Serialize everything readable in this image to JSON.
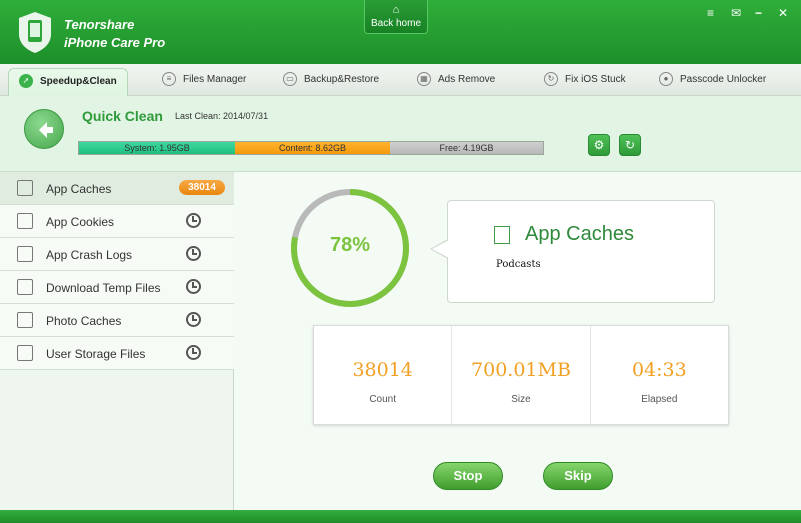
{
  "app": {
    "brand_line1": "Tenorshare",
    "brand_line2": "iPhone Care Pro",
    "back_home": "Back home"
  },
  "tabs": [
    {
      "label": "Speedup&Clean",
      "active": true,
      "icon": "rocket-icon"
    },
    {
      "label": "Files Manager",
      "icon": "files-icon"
    },
    {
      "label": "Backup&Restore",
      "icon": "folder-icon"
    },
    {
      "label": "Ads Remove",
      "icon": "grid-icon"
    },
    {
      "label": "Fix iOS Stuck",
      "icon": "fix-icon"
    },
    {
      "label": "Passcode Unlocker",
      "icon": "user-icon"
    }
  ],
  "quick_clean": {
    "title": "Quick Clean",
    "last_clean": "Last Clean: 2014/07/31",
    "system": "System: 1.95GB",
    "content": "Content: 8.62GB",
    "free": "Free: 4.19GB"
  },
  "sidebar": {
    "items": [
      {
        "label": "App Caches",
        "badge": "38014",
        "icon": "app-caches-icon"
      },
      {
        "label": "App Cookies",
        "icon": "cookies-icon"
      },
      {
        "label": "App Crash Logs",
        "icon": "crash-logs-icon"
      },
      {
        "label": "Download Temp Files",
        "icon": "download-icon"
      },
      {
        "label": "Photo Caches",
        "icon": "photo-icon"
      },
      {
        "label": "User Storage Files",
        "icon": "storage-icon"
      }
    ]
  },
  "progress": {
    "percent_text": "78%",
    "fraction": 0.78
  },
  "scan": {
    "title": "App Caches",
    "current_item": "Podcasts"
  },
  "stats": [
    {
      "value": "38014",
      "caption": "Count"
    },
    {
      "value": "700.01MB",
      "caption": "Size"
    },
    {
      "value": "04:33",
      "caption": "Elapsed"
    }
  ],
  "buttons": {
    "stop": "Stop",
    "skip": "Skip"
  },
  "colors": {
    "brand_green": "#23962f",
    "accent_orange": "#f2a024",
    "progress_green": "#7cc440"
  }
}
